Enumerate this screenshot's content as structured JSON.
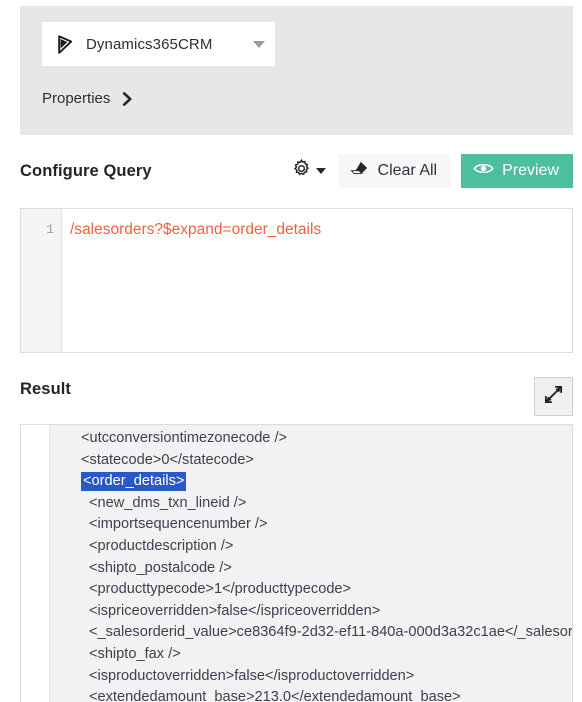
{
  "connector": {
    "name": "Dynamics365CRM",
    "logo_icon": "dynamics365-logo-icon",
    "dropdown_icon": "chevron-down-icon",
    "properties_label": "Properties",
    "properties_icon": "chevron-right-icon"
  },
  "configure_query": {
    "title": "Configure Query",
    "gear_icon": "gear-icon",
    "gear_caret_icon": "caret-down-icon",
    "clear_all_label": "Clear All",
    "clear_all_icon": "eraser-icon",
    "preview_label": "Preview",
    "preview_icon": "eye-icon",
    "preview_color": "#4ebf9e"
  },
  "editor": {
    "line_number": "1",
    "query_text": "/salesorders?$expand=order_details",
    "query_color": "#f4603e"
  },
  "result": {
    "title": "Result",
    "expand_icon": "expand-diagonal-arrows-icon",
    "highlight_color": "#2b58c9",
    "lines": [
      {
        "text": "<utcconversiontimezonecode />",
        "indent": 1,
        "highlighted": false
      },
      {
        "text": "<statecode>0</statecode>",
        "indent": 1,
        "highlighted": false
      },
      {
        "text": "<order_details>",
        "indent": 1,
        "highlighted": true
      },
      {
        "text": "<new_dms_txn_lineid />",
        "indent": 2,
        "highlighted": false
      },
      {
        "text": "<importsequencenumber />",
        "indent": 2,
        "highlighted": false
      },
      {
        "text": "<productdescription />",
        "indent": 2,
        "highlighted": false
      },
      {
        "text": "<shipto_postalcode />",
        "indent": 2,
        "highlighted": false
      },
      {
        "text": "<producttypecode>1</producttypecode>",
        "indent": 2,
        "highlighted": false
      },
      {
        "text": "<ispriceoverridden>false</ispriceoverridden>",
        "indent": 2,
        "highlighted": false
      },
      {
        "text": "<_salesorderid_value>ce8364f9-2d32-ef11-840a-000d3a32c1ae</_salesor",
        "indent": 2,
        "highlighted": false
      },
      {
        "text": "<shipto_fax />",
        "indent": 2,
        "highlighted": false
      },
      {
        "text": "<isproductoverridden>false</isproductoverridden>",
        "indent": 2,
        "highlighted": false
      },
      {
        "text": "<extendedamount_base>213.0</extendedamount_base>",
        "indent": 2,
        "highlighted": false
      }
    ]
  }
}
